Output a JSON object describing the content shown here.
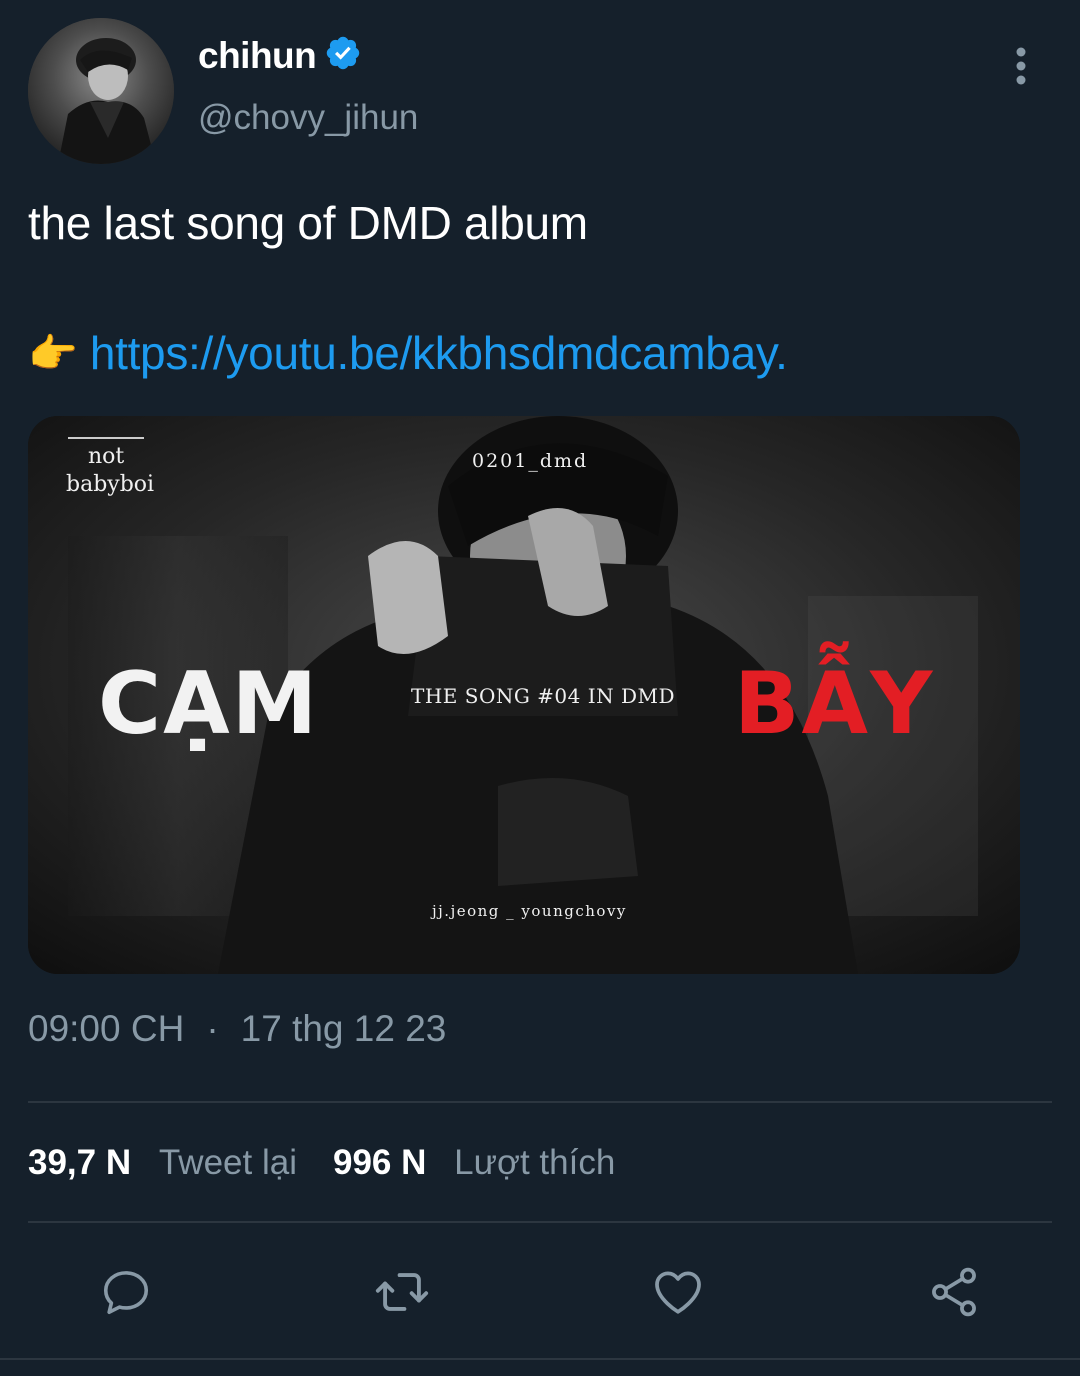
{
  "author": {
    "display_name": "chihun",
    "handle": "@chovy_jihun",
    "verified": true
  },
  "tweet": {
    "text": "the last song of DMD album",
    "pointer_emoji": "👉",
    "link": "https://youtu.be/kkbhsdmdcambay."
  },
  "media": {
    "corner_top_line": "not",
    "corner_bottom_line": "babyboi",
    "code": "0201_dmd",
    "word_left": "CẠM",
    "subtitle": "THE SONG #04 IN DMD",
    "word_right": "BẪY",
    "credit": "jj.jeong _ youngchovy",
    "accent_color": "#e31e24"
  },
  "meta": {
    "time": "09:00 CH",
    "separator": "·",
    "date": "17 thg 12 23"
  },
  "stats": {
    "retweets_count": "39,7 N",
    "retweets_label": "Tweet lại",
    "likes_count": "996 N",
    "likes_label": "Lượt thích"
  },
  "actions": [
    "reply-icon",
    "retweet-icon",
    "like-icon",
    "share-icon"
  ],
  "colors": {
    "background": "#15202b",
    "link": "#1d9bf0",
    "verified": "#1d9bf0",
    "secondary_text": "#8899a6"
  }
}
